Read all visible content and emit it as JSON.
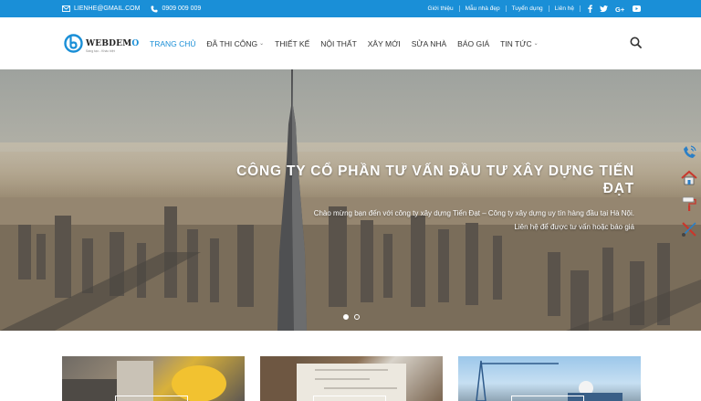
{
  "topbar": {
    "email": "LIENHE@GMAIL.COM",
    "phone": "0909 009 009",
    "links": [
      "Giới thiệu",
      "Mẫu nhà đẹp",
      "Tuyển dụng",
      "Liên hệ"
    ],
    "social_icons": [
      "facebook-icon",
      "twitter-icon",
      "google-plus-icon",
      "youtube-icon"
    ]
  },
  "logo": {
    "text_main": "WEBDEM",
    "text_accent": "O",
    "tagline": "Sáng tạo - Khác biệt"
  },
  "nav": {
    "items": [
      {
        "label": "TRANG CHỦ",
        "active": true,
        "dropdown": false
      },
      {
        "label": "ĐÃ THI CÔNG",
        "active": false,
        "dropdown": true
      },
      {
        "label": "THIẾT KẾ",
        "active": false,
        "dropdown": false
      },
      {
        "label": "NỘI THẤT",
        "active": false,
        "dropdown": false
      },
      {
        "label": "XÂY MỚI",
        "active": false,
        "dropdown": false
      },
      {
        "label": "SỬA NHÀ",
        "active": false,
        "dropdown": false
      },
      {
        "label": "BÁO GIÁ",
        "active": false,
        "dropdown": false
      },
      {
        "label": "TIN TỨC",
        "active": false,
        "dropdown": true
      }
    ]
  },
  "hero": {
    "title_line1": "CÔNG TY CỔ PHẦN TƯ VẤN ĐẦU TƯ XÂY DỰNG TIẾN",
    "title_line2": "ĐẠT",
    "subtitle_line1": "Chào mừng bạn đến với công ty xây dựng Tiến Đạt – Công ty xây dựng uy tín hàng đầu tại Hà Nội.",
    "subtitle_line2": "Liên hệ để được tư vấn hoặc báo giá",
    "slides": 2,
    "current_slide": 1
  },
  "side_icons": [
    "phone-call-icon",
    "house-icon",
    "paint-roller-icon",
    "tools-icon"
  ],
  "colors": {
    "accent": "#1a8fd7",
    "topbar_bg": "#1a8fd7",
    "nav_text": "#333333"
  }
}
